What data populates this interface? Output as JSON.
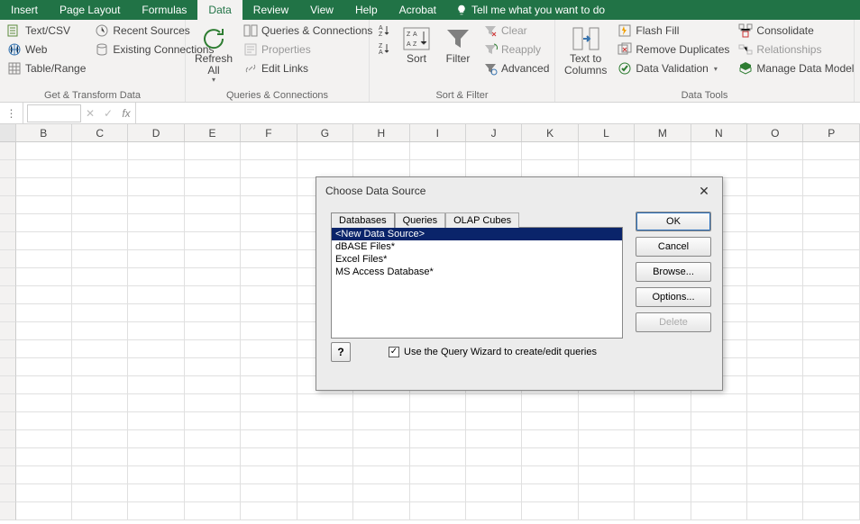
{
  "ribbonTabs": {
    "insert": "Insert",
    "pageLayout": "Page Layout",
    "formulas": "Formulas",
    "data": "Data",
    "review": "Review",
    "view": "View",
    "help": "Help",
    "acrobat": "Acrobat",
    "tellMe": "Tell me what you want to do"
  },
  "getTransform": {
    "textCsv": "Text/CSV",
    "web": "Web",
    "tableRange": "Table/Range",
    "recentSources": "Recent Sources",
    "existingConnections": "Existing Connections",
    "groupLabel": "Get & Transform Data"
  },
  "queriesConn": {
    "refreshAll": "Refresh All",
    "dropdown": "▾",
    "queriesConnections": "Queries & Connections",
    "properties": "Properties",
    "editLinks": "Edit Links",
    "groupLabel": "Queries & Connections"
  },
  "sortFilter": {
    "sort": "Sort",
    "filter": "Filter",
    "clear": "Clear",
    "reapply": "Reapply",
    "advanced": "Advanced",
    "groupLabel": "Sort & Filter"
  },
  "dataTools": {
    "textToColumns": "Text to Columns",
    "flashFill": "Flash Fill",
    "removeDuplicates": "Remove Duplicates",
    "dataValidation": "Data Validation",
    "dropdown": "▾",
    "consolidate": "Consolidate",
    "relationships": "Relationships",
    "manageDataModel": "Manage Data Model",
    "groupLabel": "Data Tools"
  },
  "formulaBar": {
    "cancel": "✕",
    "enter": "✓",
    "fx": "fx"
  },
  "columns": [
    "B",
    "C",
    "D",
    "E",
    "F",
    "G",
    "H",
    "I",
    "J",
    "K",
    "L",
    "M",
    "N",
    "O",
    "P"
  ],
  "dialog": {
    "title": "Choose Data Source",
    "tabs": {
      "databases": "Databases",
      "queries": "Queries",
      "olap": "OLAP Cubes"
    },
    "items": {
      "newDS": "<New Data Source>",
      "dbase": "dBASE Files*",
      "excel": "Excel Files*",
      "access": "MS Access Database*"
    },
    "buttons": {
      "ok": "OK",
      "cancel": "Cancel",
      "browse": "Browse...",
      "options": "Options...",
      "delete": "Delete"
    },
    "help": "?",
    "checkboxMark": "✓",
    "checkboxLabel": "Use the Query Wizard to create/edit queries"
  }
}
